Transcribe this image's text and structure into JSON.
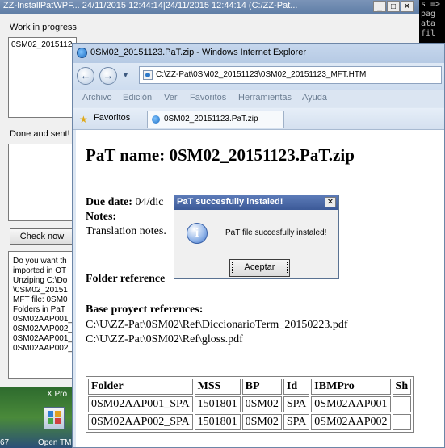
{
  "back_window": {
    "title": "ZZ-InstallPatWPF... 24/11/2015 12:44:14|24/11/2015 12:44:14 (C:/ZZ-Pat...",
    "work_label": "Work in progress",
    "work_item": "0SM02_2015112",
    "done_label": "Done and sent!",
    "check_button": "Check now",
    "log_lines": [
      "Do you want th",
      "imported in OT",
      "Unziping C:\\Do",
      "\\0SM02_20151",
      "MFT file: 0SM0",
      "Folders in PaT",
      "0SM02AAP001_",
      "0SM02AAP002_",
      "0SM02AAP001_",
      "0SM02AAP002_"
    ]
  },
  "console": {
    "lines": [
      "s =>",
      "pag",
      "",
      "ata",
      "fil"
    ]
  },
  "desktop": {
    "icon_label": "Open TM",
    "left_label": "67",
    "top_label": "X Pro"
  },
  "ie": {
    "title": "0SM02_20151123.PaT.zip - Windows Internet Explorer",
    "address": "C:\\ZZ-Pat\\0SM02_20151123\\0SM02_20151123_MFT.HTM",
    "menu": [
      "Archivo",
      "Edición",
      "Ver",
      "Favoritos",
      "Herramientas",
      "Ayuda"
    ],
    "favorites_label": "Favoritos",
    "tab_label": "0SM02_20151123.PaT.zip"
  },
  "page": {
    "heading": "PaT name: 0SM02_20151123.PaT.zip",
    "due_label": "Due date:",
    "due_value": "04/dic",
    "notes_label": "Notes:",
    "notes_value": "Translation notes.",
    "folder_ref_label": "Folder reference",
    "base_ref_label": "Base proyect references:",
    "base_refs": [
      "C:\\U\\ZZ-Pat\\0SM02\\Ref\\DiccionarioTerm_20150223.pdf",
      "C:\\U\\ZZ-Pat\\0SM02\\Ref\\gloss.pdf"
    ],
    "table": {
      "headers": [
        "Folder",
        "MSS",
        "BP",
        "Id",
        "IBMPro",
        "Sh"
      ],
      "rows": [
        [
          "0SM02AAP001_SPA",
          "1501801",
          "0SM02",
          "SPA",
          "0SM02AAP001",
          ""
        ],
        [
          "0SM02AAP002_SPA",
          "1501801",
          "0SM02",
          "SPA",
          "0SM02AAP002",
          ""
        ]
      ]
    }
  },
  "dialog": {
    "title": "PaT succesfully instaled!",
    "message": "PaT file succesfully instaled!",
    "ok_button": "Aceptar"
  }
}
